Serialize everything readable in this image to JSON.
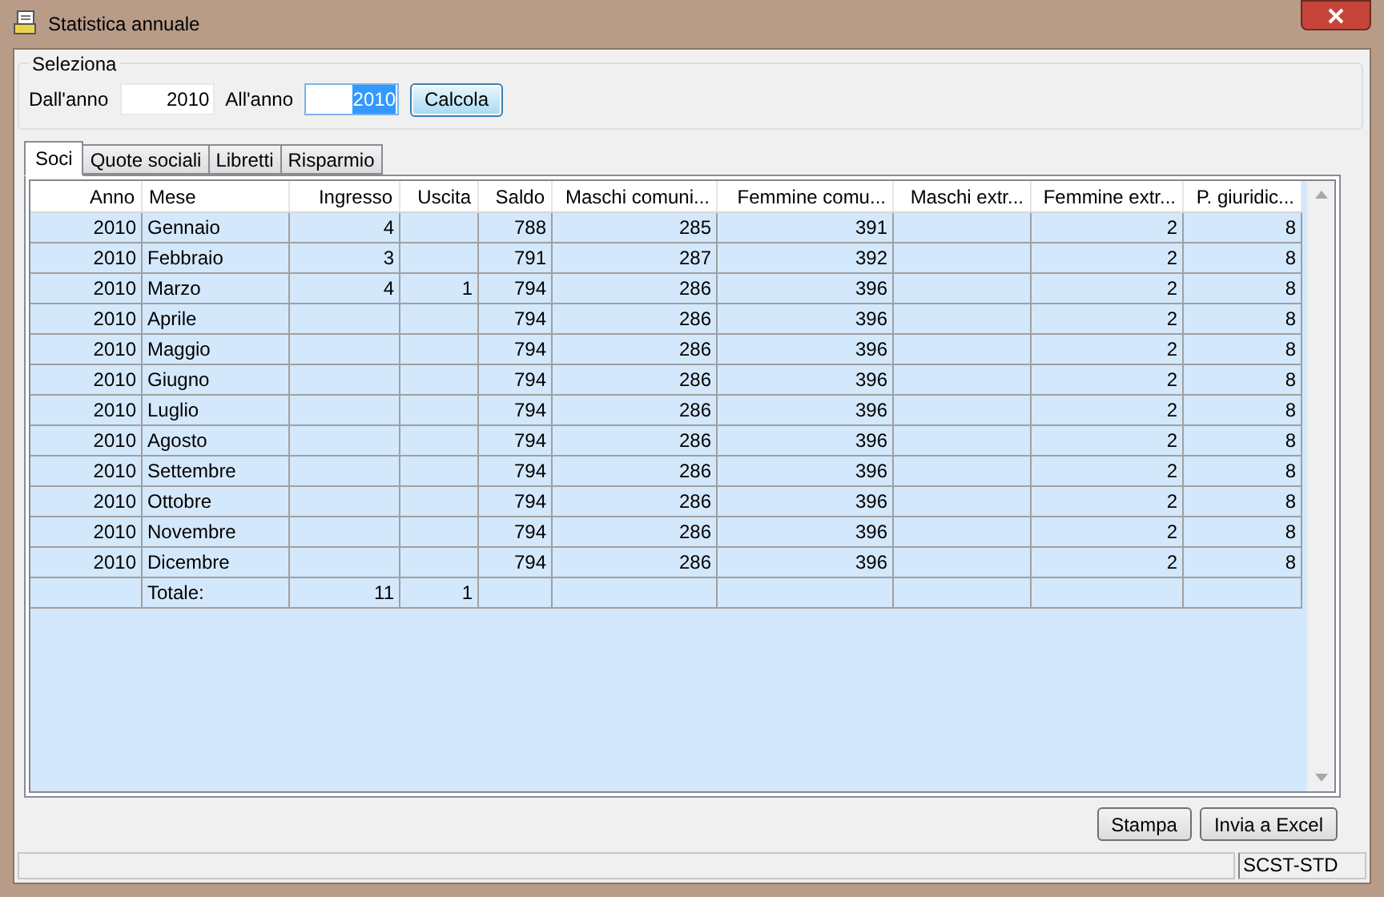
{
  "window": {
    "title": "Statistica annuale"
  },
  "selection": {
    "legend": "Seleziona",
    "from_label": "Dall'anno",
    "from_value": "2010",
    "to_label": "All'anno",
    "to_value": "2010",
    "to_selected": true,
    "calc_button": "Calcola"
  },
  "tabs": [
    {
      "label": "Soci",
      "selected": true
    },
    {
      "label": "Quote sociali",
      "selected": false
    },
    {
      "label": "Libretti",
      "selected": false
    },
    {
      "label": "Risparmio",
      "selected": false
    }
  ],
  "table": {
    "columns": [
      "Anno",
      "Mese",
      "Ingresso",
      "Uscita",
      "Saldo",
      "Maschi comuni...",
      "Femmine comu...",
      "Maschi extr...",
      "Femmine extr...",
      "P. giuridic..."
    ],
    "rows": [
      [
        "2010",
        "Gennaio",
        "4",
        null,
        "788",
        "285",
        "391",
        null,
        "2",
        "8"
      ],
      [
        "2010",
        "Febbraio",
        "3",
        null,
        "791",
        "287",
        "392",
        null,
        "2",
        "8"
      ],
      [
        "2010",
        "Marzo",
        "4",
        "1",
        "794",
        "286",
        "396",
        null,
        "2",
        "8"
      ],
      [
        "2010",
        "Aprile",
        null,
        null,
        "794",
        "286",
        "396",
        null,
        "2",
        "8"
      ],
      [
        "2010",
        "Maggio",
        null,
        null,
        "794",
        "286",
        "396",
        null,
        "2",
        "8"
      ],
      [
        "2010",
        "Giugno",
        null,
        null,
        "794",
        "286",
        "396",
        null,
        "2",
        "8"
      ],
      [
        "2010",
        "Luglio",
        null,
        null,
        "794",
        "286",
        "396",
        null,
        "2",
        "8"
      ],
      [
        "2010",
        "Agosto",
        null,
        null,
        "794",
        "286",
        "396",
        null,
        "2",
        "8"
      ],
      [
        "2010",
        "Settembre",
        null,
        null,
        "794",
        "286",
        "396",
        null,
        "2",
        "8"
      ],
      [
        "2010",
        "Ottobre",
        null,
        null,
        "794",
        "286",
        "396",
        null,
        "2",
        "8"
      ],
      [
        "2010",
        "Novembre",
        null,
        null,
        "794",
        "286",
        "396",
        null,
        "2",
        "8"
      ],
      [
        "2010",
        "Dicembre",
        null,
        null,
        "794",
        "286",
        "396",
        null,
        "2",
        "8"
      ],
      [
        null,
        "Totale:",
        "11",
        "1",
        null,
        null,
        null,
        null,
        null,
        null
      ]
    ]
  },
  "buttons": [
    "Stampa",
    "Invia a Excel"
  ],
  "status_bar": {
    "panel_2": "SCST-STD"
  }
}
